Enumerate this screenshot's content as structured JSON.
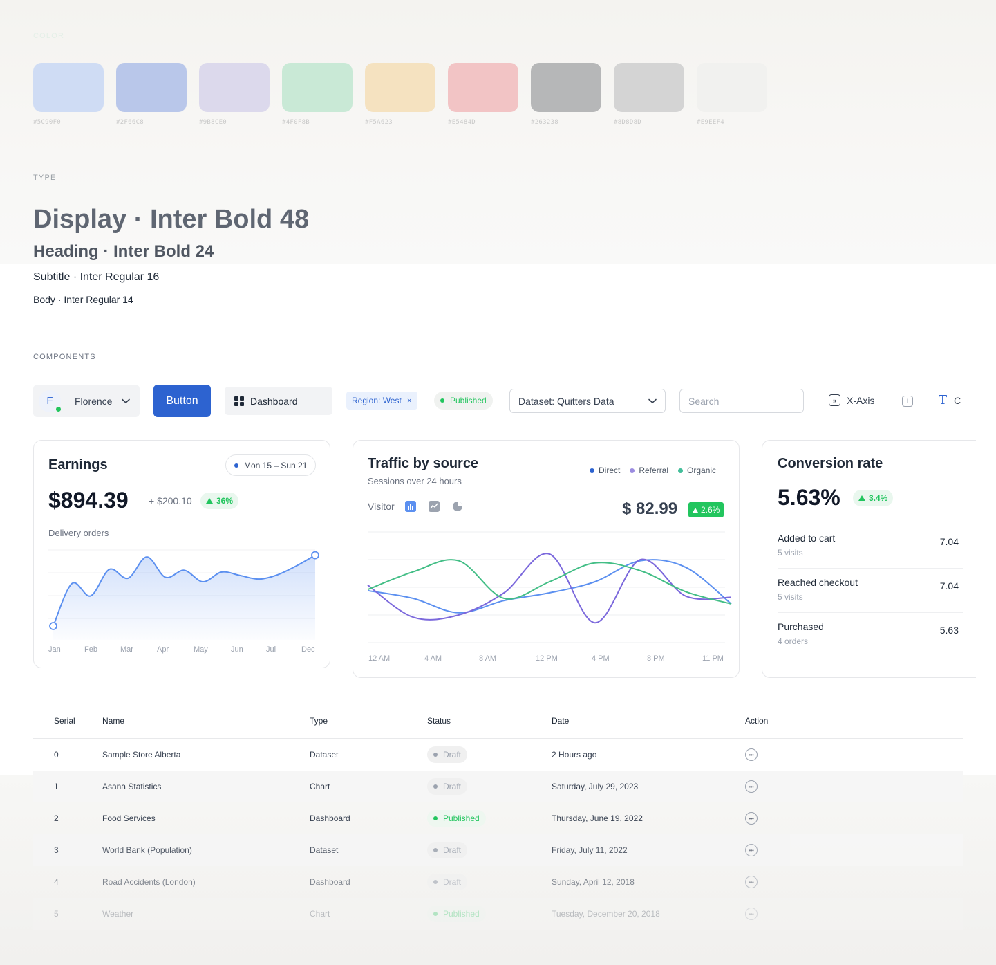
{
  "sections": {
    "color": "COLOR",
    "type": "TYPE",
    "components": "COMPONENTS"
  },
  "swatches": [
    {
      "hex": "#5C90F0",
      "color": "#cfdcf4"
    },
    {
      "hex": "#2F66C8",
      "color": "#b9c7ea"
    },
    {
      "hex": "#9B8CE0",
      "color": "#dcd9ec"
    },
    {
      "hex": "#4F0F8B",
      "color": "#c9e9d6"
    },
    {
      "hex": "#F5A623",
      "color": "#f5e2c0"
    },
    {
      "hex": "#E5484D",
      "color": "#f2c4c5"
    },
    {
      "hex": "#263238",
      "color": "#b6b7b8"
    },
    {
      "hex": "#8D8D8D",
      "color": "#d4d4d4"
    },
    {
      "hex": "#E9EEF4",
      "color": "#f1f1ef"
    }
  ],
  "type_samples": {
    "display": "Display · Inter Bold 48",
    "heading": "Heading · Inter Bold 24",
    "subtitle": "Subtitle · Inter Regular 16",
    "body": "Body · Inter Regular 14"
  },
  "components": {
    "user": {
      "initial": "F",
      "name": "Florence"
    },
    "primary_button": "Button",
    "dashboard_button": "Dashboard",
    "region_chip": "Region: West",
    "region_chip_close": "×",
    "published_chip": "Published",
    "dataset_select": "Dataset: Quitters Data",
    "search_placeholder": "Search",
    "xaxis_button": "X-Axis",
    "text_button": "C"
  },
  "earnings": {
    "title": "Earnings",
    "date_range": "Mon 15 – Sun 21",
    "amount": "$894.39",
    "delta": "+ $200.10",
    "change": "36%",
    "subtitle": "Delivery orders"
  },
  "traffic": {
    "title": "Traffic by source",
    "subtitle": "Sessions over 24 hours",
    "legend": [
      "Direct",
      "Referral",
      "Organic"
    ],
    "visitor_label": "Visitor",
    "price": "$ 82.99",
    "change": "2.6%"
  },
  "conversion": {
    "title": "Conversion rate",
    "rate": "5.63%",
    "change": "3.4%",
    "rows": [
      {
        "label": "Added to cart",
        "sub": "5 visits",
        "value": "7.04"
      },
      {
        "label": "Reached checkout",
        "sub": "5 visits",
        "value": "7.04"
      },
      {
        "label": "Purchased",
        "sub": "4 orders",
        "value": "5.63"
      }
    ]
  },
  "chart_data": [
    {
      "type": "area",
      "categories": [
        "Jan",
        "Feb",
        "Mar",
        "Apr",
        "May",
        "Jun",
        "Jul",
        "Dec"
      ],
      "x": [
        0,
        1,
        2,
        3,
        4,
        5,
        6,
        7,
        8,
        9,
        10,
        11,
        12,
        13,
        14
      ],
      "values": [
        0,
        48,
        34,
        64,
        54,
        78,
        55,
        63,
        50,
        61,
        57,
        53,
        58,
        68,
        80
      ],
      "xlabel": "",
      "ylabel": "",
      "grid": true
    },
    {
      "type": "line",
      "categories": [
        "12 AM",
        "4 AM",
        "8 AM",
        "12 PM",
        "4 PM",
        "8 PM",
        "11 PM"
      ],
      "series": [
        {
          "name": "Direct",
          "color": "#5c90f0",
          "values": [
            47,
            40,
            27,
            38,
            45,
            55,
            74,
            68,
            35
          ]
        },
        {
          "name": "Referral",
          "color": "#7b68dc",
          "values": [
            52,
            23,
            25,
            45,
            80,
            18,
            75,
            42,
            41
          ]
        },
        {
          "name": "Organic",
          "color": "#43be86",
          "values": [
            48,
            64,
            74,
            40,
            55,
            72,
            65,
            46,
            35
          ]
        }
      ],
      "ylim": [
        0,
        100
      ],
      "grid": true
    }
  ],
  "table": {
    "headers": [
      "Serial",
      "Name",
      "Type",
      "Status",
      "Date",
      "Action"
    ],
    "rows": [
      {
        "serial": "0",
        "name": "Sample Store Alberta",
        "type": "Dataset",
        "status": "Draft",
        "date": "2 Hours ago"
      },
      {
        "serial": "1",
        "name": "Asana Statistics",
        "type": "Chart",
        "status": "Draft",
        "date": "Saturday, July 29, 2023"
      },
      {
        "serial": "2",
        "name": "Food Services",
        "type": "Dashboard",
        "status": "Published",
        "date": "Thursday, June 19, 2022"
      },
      {
        "serial": "3",
        "name": "World Bank (Population)",
        "type": "Dataset",
        "status": "Draft",
        "date": "Friday, July 11, 2022"
      },
      {
        "serial": "4",
        "name": "Road Accidents (London)",
        "type": "Dashboard",
        "status": "Draft",
        "date": "Sunday, April 12, 2018"
      },
      {
        "serial": "5",
        "name": "Weather",
        "type": "Chart",
        "status": "Published",
        "date": "Tuesday, December 20, 2018"
      }
    ]
  }
}
